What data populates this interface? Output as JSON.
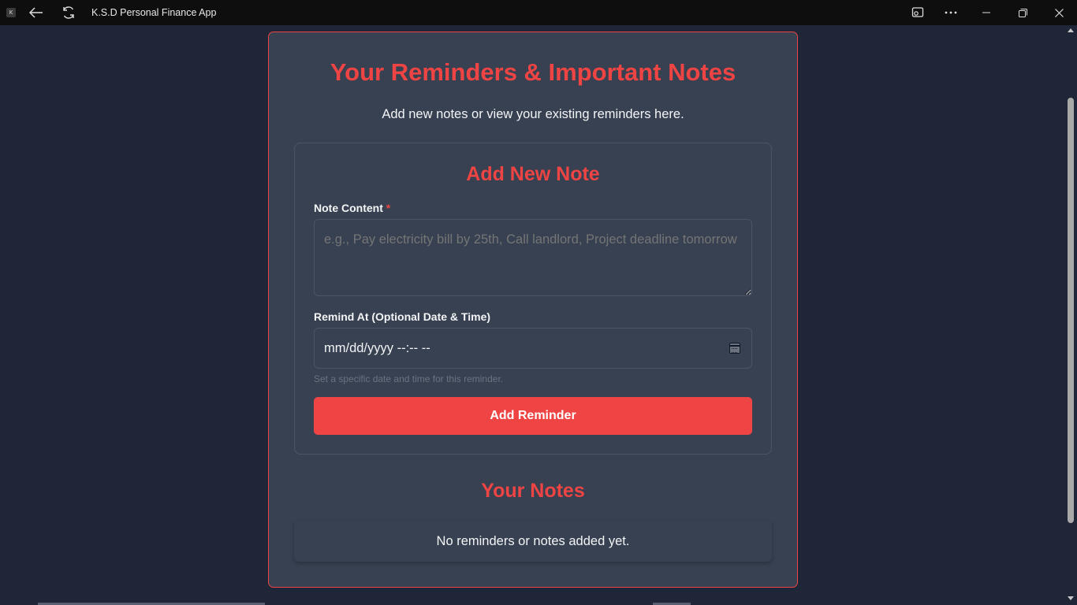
{
  "window": {
    "app_icon": "K",
    "title": "K.S.D Personal Finance App"
  },
  "page": {
    "title": "Your Reminders & Important Notes",
    "subtitle": "Add new notes or view your existing reminders here."
  },
  "form": {
    "title": "Add New Note",
    "content_label": "Note Content",
    "required_marker": "*",
    "content_placeholder": "e.g., Pay electricity bill by 25th, Call landlord, Project deadline tomorrow",
    "content_value": "",
    "remind_label": "Remind At (Optional Date & Time)",
    "remind_value": "mm/dd/yyyy --:-- --",
    "remind_hint": "Set a specific date and time for this reminder.",
    "submit_label": "Add Reminder"
  },
  "notes": {
    "title": "Your Notes",
    "empty_message": "No reminders or notes added yet."
  },
  "colors": {
    "accent": "#ef4444",
    "background": "#1e2637",
    "card": "#374151"
  }
}
